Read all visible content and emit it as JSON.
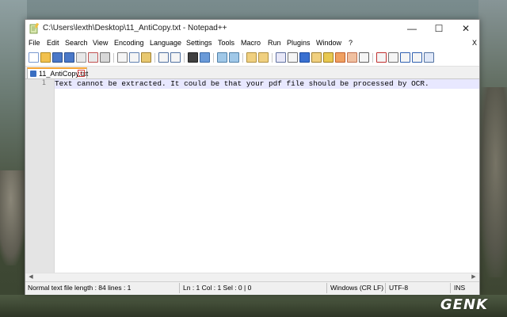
{
  "window": {
    "title": "C:\\Users\\lexth\\Desktop\\11_AntiCopy.txt - Notepad++",
    "minimize": "—",
    "maximize": "☐",
    "close": "✕"
  },
  "menu": {
    "items": [
      "File",
      "Edit",
      "Search",
      "View",
      "Encoding",
      "Language",
      "Settings",
      "Tools",
      "Macro",
      "Run",
      "Plugins",
      "Window",
      "?"
    ],
    "close_doc": "X"
  },
  "tabs": [
    {
      "label": "11_AntiCopy.txt",
      "active": true
    }
  ],
  "editor": {
    "lines": [
      {
        "number": "1",
        "text": "Text cannot be extracted. It could be that your pdf file should be processed by OCR."
      }
    ]
  },
  "status": {
    "file_info": "Normal text file length : 84   lines : 1",
    "position": "Ln : 1   Col : 1   Sel : 0 | 0",
    "eol": "Windows (CR LF)",
    "encoding": "UTF-8",
    "mode": "INS"
  },
  "watermark": "GENK",
  "colors": {
    "tab_accent": "#f6a534",
    "current_line": "#e8e8ff",
    "gutter": "#e4e4e4"
  }
}
